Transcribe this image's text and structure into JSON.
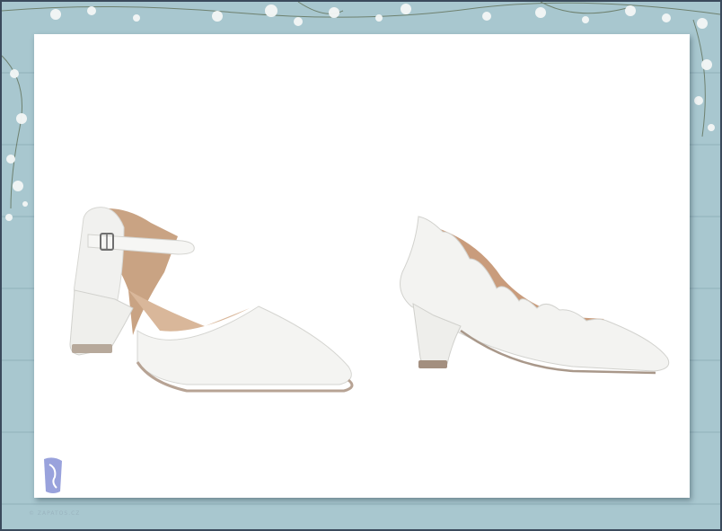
{
  "image": {
    "background_color": "#a8c7cf",
    "panel_color": "#ffffff",
    "frame_color": "#3a4a5c",
    "watermark_text": "© ZAPATOS.CZ"
  },
  "products": [
    {
      "name": "ankle-strap-pointed-pump",
      "color": "#f3f3f1",
      "lining": "#caa484"
    },
    {
      "name": "scalloped-pointed-pump",
      "color": "#f3f3f1",
      "lining": "#c99c7d"
    }
  ]
}
